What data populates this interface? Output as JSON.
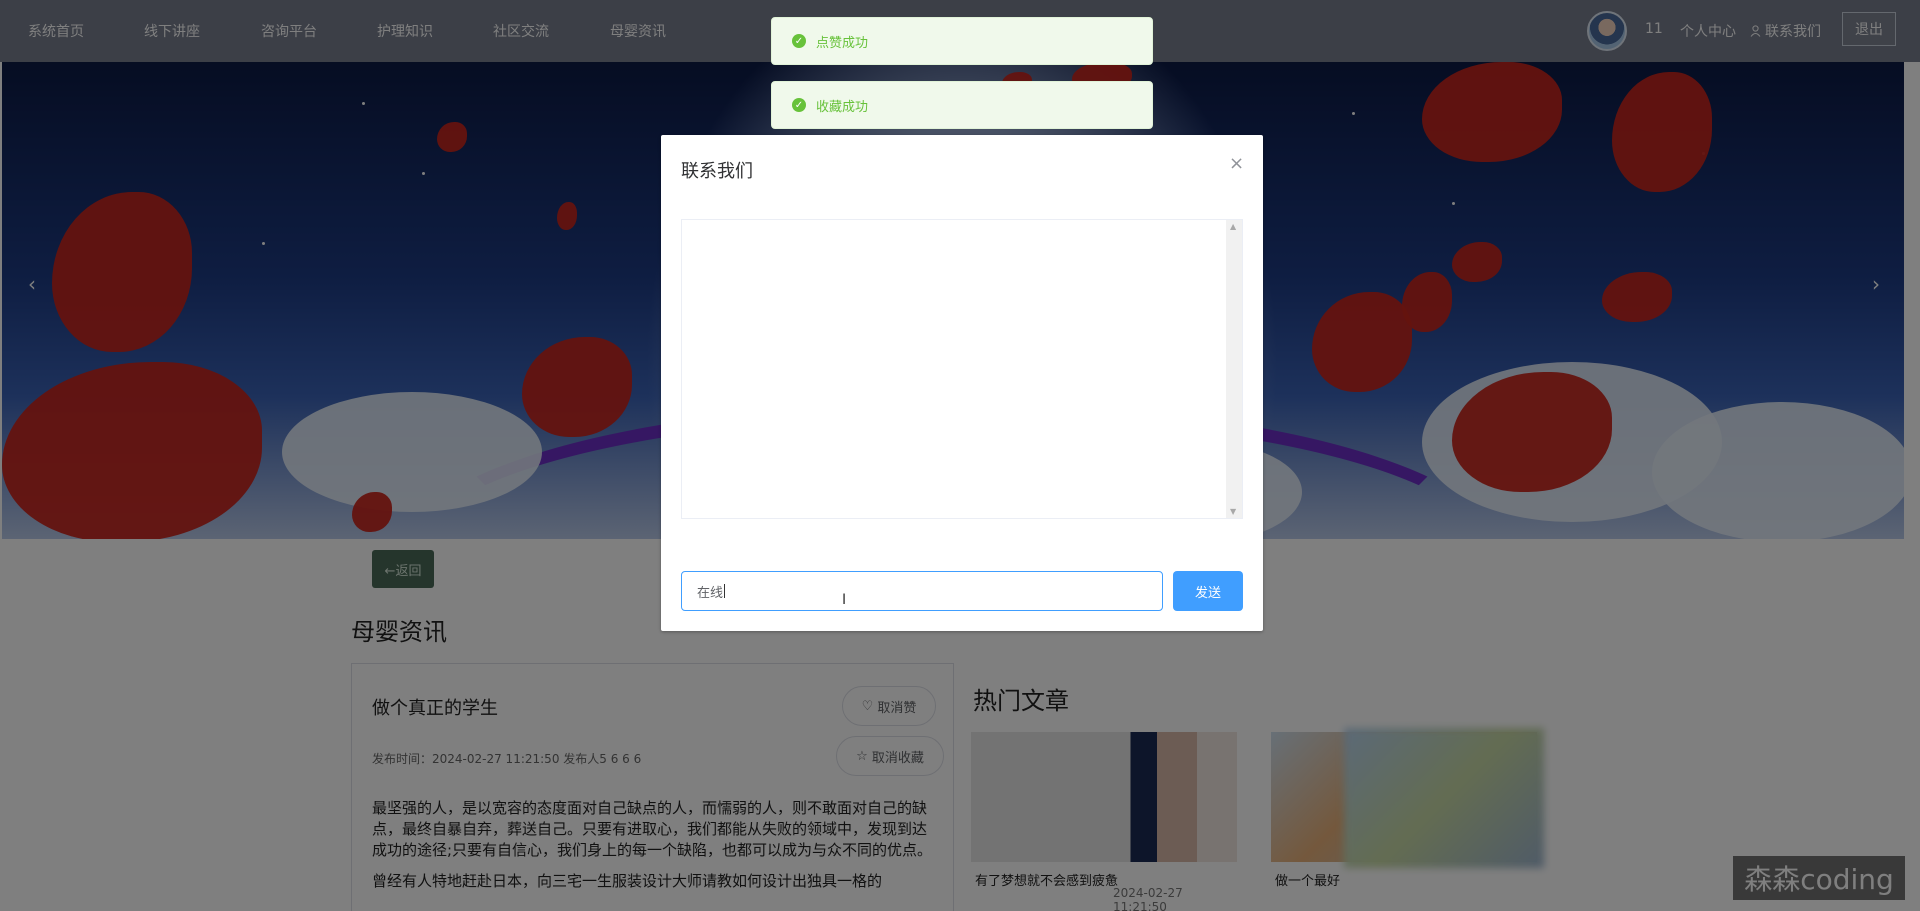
{
  "nav": {
    "items": [
      "系统首页",
      "线下讲座",
      "咨询平台",
      "护理知识",
      "社区交流",
      "母婴资讯"
    ],
    "user_num": "11",
    "user_center": "个人中心",
    "contact": "联系我们",
    "logout": "退出"
  },
  "banner": {
    "prev_icon": "chevron-left-icon",
    "next_icon": "chevron-right-icon",
    "prev": "‹",
    "next": "›"
  },
  "toasts": [
    {
      "text": "点赞成功"
    },
    {
      "text": "收藏成功"
    }
  ],
  "dialog": {
    "title": "联系我们",
    "close": "×",
    "input_value": "在线",
    "send": "发送"
  },
  "page": {
    "back": "←返回",
    "section_title": "母婴资讯",
    "article": {
      "title": "做个真正的学生",
      "unlike": "取消赞",
      "uncollect": "取消收藏",
      "meta": "发布时间：2024-02-27 11:21:50  发布人5  6  6  6",
      "body": "最坚强的人，是以宽容的态度面对自己缺点的人，而懦弱的人，则不敢面对自己的缺点，最终自暴自弃，葬送自己。只要有进取心，我们都能从失败的领域中，发现到达成功的途径;只要有自信心，我们身上的每一个缺陷，也都可以成为与众不同的优点。",
      "body2": "曾经有人特地赶赴日本，向三宅一生服装设计大师请教如何设计出独具一格的"
    },
    "hot_title": "热门文章",
    "hot": [
      {
        "caption": "有了梦想就不会感到疲惫",
        "date": "2024-02-27 11:21:50"
      },
      {
        "caption": "做一个最好"
      }
    ],
    "watermark": "森森coding"
  },
  "colors": {
    "primary": "#409eff",
    "success": "#67c23a",
    "back_button": "#4a6a58"
  }
}
